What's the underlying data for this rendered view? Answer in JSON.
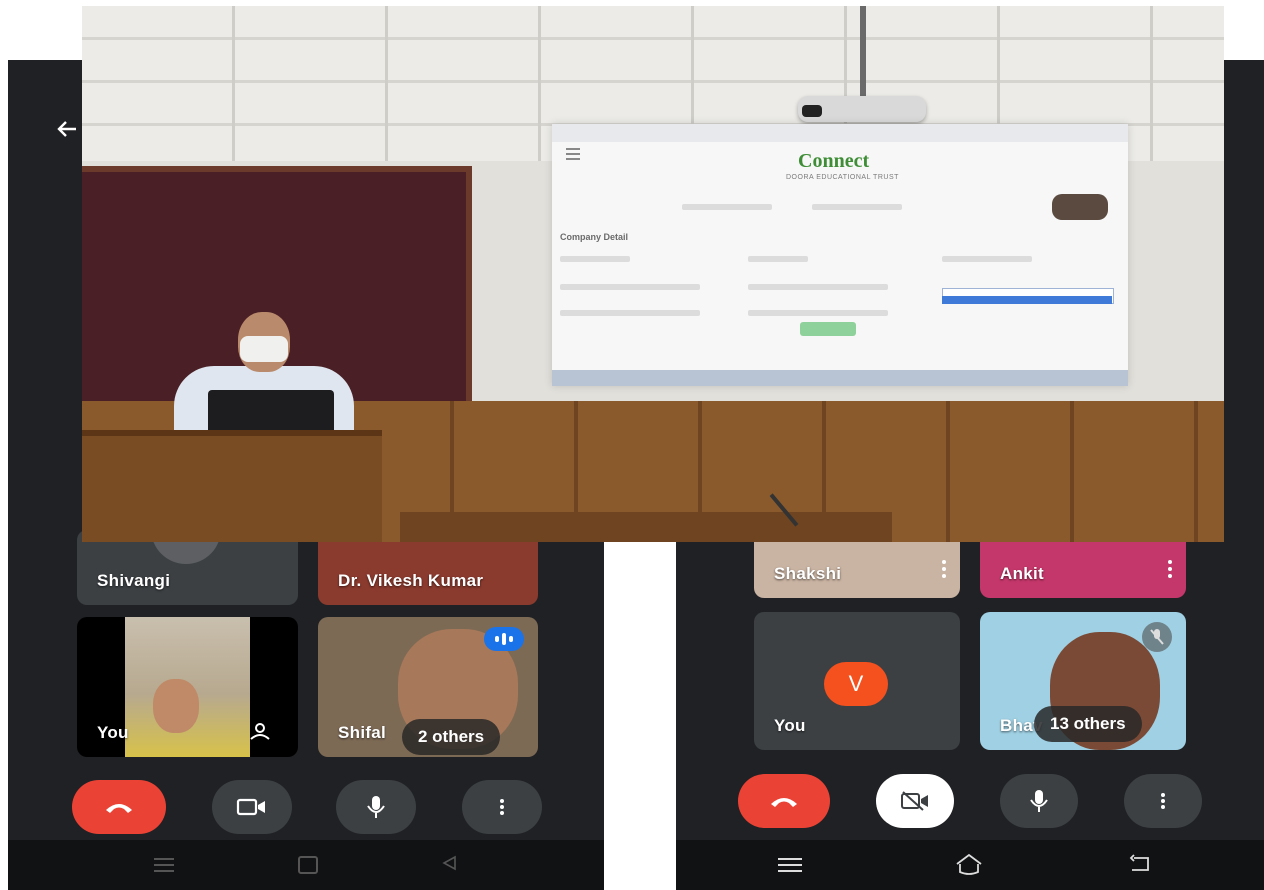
{
  "left_screen": {
    "back_icon": "arrow-back-icon",
    "tiles": [
      {
        "name": "Shivangi"
      },
      {
        "name": "Dr. Vikesh Kumar"
      },
      {
        "name": "You",
        "icon": "camera-switch-icon"
      },
      {
        "name": "Shifal",
        "badge_icon": "speaking-indicator-icon",
        "chip": "2 others"
      }
    ],
    "controls": [
      {
        "name": "end-call",
        "icon": "phone-hangup-icon",
        "color": "#ea4335"
      },
      {
        "name": "camera",
        "icon": "videocam-icon"
      },
      {
        "name": "microphone",
        "icon": "mic-icon"
      },
      {
        "name": "more-options",
        "icon": "more-vert-icon"
      }
    ],
    "nav": [
      "menu-icon",
      "home-icon",
      "back-triangle-icon"
    ]
  },
  "right_screen": {
    "tiles": [
      {
        "name": "Shakshi"
      },
      {
        "name": "Ankit"
      },
      {
        "name": "You",
        "avatar_letter": "V",
        "avatar_color": "#f4511e"
      },
      {
        "name": "Bhav",
        "badge_icon": "mic-off-icon",
        "chip": "13 others"
      }
    ],
    "controls": [
      {
        "name": "end-call",
        "icon": "phone-hangup-icon",
        "color": "#ea4335"
      },
      {
        "name": "camera-off",
        "icon": "videocam-off-icon"
      },
      {
        "name": "microphone",
        "icon": "mic-icon"
      },
      {
        "name": "more-options",
        "icon": "more-vert-icon"
      }
    ],
    "nav": [
      "menu-icon",
      "home-icon",
      "back-icon"
    ]
  },
  "presentation": {
    "logo_text": "Connect",
    "subtitle": "DOORA EDUCATIONAL TRUST",
    "section_heading": "Company Detail"
  },
  "colors": {
    "panel_bg": "#202124",
    "tile_bg": "#3c4043",
    "end_call": "#ea4335",
    "accent_blue": "#1a73e8"
  }
}
